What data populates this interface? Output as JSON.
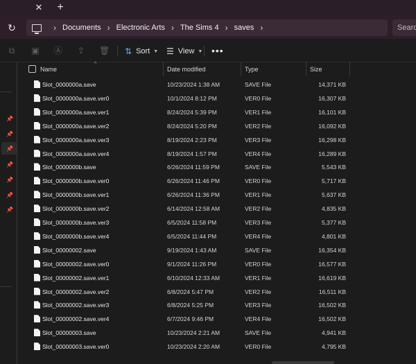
{
  "tabbar": {
    "close_icon": "close-icon",
    "new_tab_icon": "plus-icon"
  },
  "address": {
    "crumbs": [
      "Documents",
      "Electronic Arts",
      "The Sims 4",
      "saves"
    ],
    "search_placeholder": "Search"
  },
  "toolbar": {
    "sort_label": "Sort",
    "view_label": "View",
    "more_label": "•••"
  },
  "columns": {
    "name": "Name",
    "date": "Date modified",
    "type": "Type",
    "size": "Size"
  },
  "files": [
    {
      "name": "Slot_0000000a.save",
      "date": "10/23/2024 1:38 AM",
      "type": "SAVE File",
      "size": "14,371 KB"
    },
    {
      "name": "Slot_0000000a.save.ver0",
      "date": "10/1/2024 8:12 PM",
      "type": "VER0 File",
      "size": "16,307 KB"
    },
    {
      "name": "Slot_0000000a.save.ver1",
      "date": "8/24/2024 5:39 PM",
      "type": "VER1 File",
      "size": "16,101 KB"
    },
    {
      "name": "Slot_0000000a.save.ver2",
      "date": "8/24/2024 5:20 PM",
      "type": "VER2 File",
      "size": "16,092 KB"
    },
    {
      "name": "Slot_0000000a.save.ver3",
      "date": "8/19/2024 2:23 PM",
      "type": "VER3 File",
      "size": "16,298 KB"
    },
    {
      "name": "Slot_0000000a.save.ver4",
      "date": "8/19/2024 1:57 PM",
      "type": "VER4 File",
      "size": "16,289 KB"
    },
    {
      "name": "Slot_0000000b.save",
      "date": "6/26/2024 11:59 PM",
      "type": "SAVE File",
      "size": "5,543 KB"
    },
    {
      "name": "Slot_0000000b.save.ver0",
      "date": "6/26/2024 11:46 PM",
      "type": "VER0 File",
      "size": "5,717 KB"
    },
    {
      "name": "Slot_0000000b.save.ver1",
      "date": "6/26/2024 11:36 PM",
      "type": "VER1 File",
      "size": "5,637 KB"
    },
    {
      "name": "Slot_0000000b.save.ver2",
      "date": "6/14/2024 12:58 AM",
      "type": "VER2 File",
      "size": "4,835 KB"
    },
    {
      "name": "Slot_0000000b.save.ver3",
      "date": "6/5/2024 11:58 PM",
      "type": "VER3 File",
      "size": "5,377 KB"
    },
    {
      "name": "Slot_0000000b.save.ver4",
      "date": "6/5/2024 11:44 PM",
      "type": "VER4 File",
      "size": "4,801 KB"
    },
    {
      "name": "Slot_00000002.save",
      "date": "9/19/2024 1:43 AM",
      "type": "SAVE File",
      "size": "16,354 KB"
    },
    {
      "name": "Slot_00000002.save.ver0",
      "date": "9/1/2024 11:26 PM",
      "type": "VER0 File",
      "size": "16,577 KB"
    },
    {
      "name": "Slot_00000002.save.ver1",
      "date": "6/10/2024 12:33 AM",
      "type": "VER1 File",
      "size": "16,619 KB"
    },
    {
      "name": "Slot_00000002.save.ver2",
      "date": "6/8/2024 5:47 PM",
      "type": "VER2 File",
      "size": "16,511 KB"
    },
    {
      "name": "Slot_00000002.save.ver3",
      "date": "6/8/2024 5:25 PM",
      "type": "VER3 File",
      "size": "16,502 KB"
    },
    {
      "name": "Slot_00000002.save.ver4",
      "date": "6/7/2024 9:46 PM",
      "type": "VER4 File",
      "size": "16,502 KB"
    },
    {
      "name": "Slot_00000003.save",
      "date": "10/23/2024 2:21 AM",
      "type": "SAVE File",
      "size": "4,941 KB"
    },
    {
      "name": "Slot_00000003.save.ver0",
      "date": "10/23/2024 2:20 AM",
      "type": "VER0 File",
      "size": "4,795 KB"
    }
  ]
}
